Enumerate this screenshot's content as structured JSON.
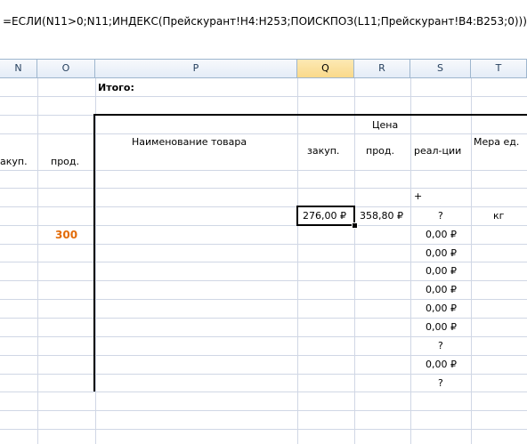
{
  "formula_bar": {
    "text": "=ЕСЛИ(N11>0;N11;ИНДЕКС(Прейскурант!H4:H253;ПОИСКПОЗ(L11;Прейскурант!B4:B253;0)))"
  },
  "columns": [
    "N",
    "O",
    "P",
    "Q",
    "R",
    "S",
    "T"
  ],
  "selected_column": "Q",
  "cells": {
    "itogo": "Итого:",
    "tsena": "Цена",
    "naimenovanie": "Наименование товара",
    "zakup": "закуп.",
    "prod": "прод.",
    "realtsii": "реал-ции",
    "mera": "Мера ед.",
    "n_header": "акуп.",
    "o_header": "прод.",
    "plus": "+",
    "o_value": "300",
    "q_value": "276,00 ₽",
    "r_value": "358,80 ₽",
    "s_values": [
      "?",
      "0,00 ₽",
      "0,00 ₽",
      "0,00 ₽",
      "0,00 ₽",
      "0,00 ₽",
      "0,00 ₽",
      "?",
      "0,00 ₽",
      "?"
    ],
    "t_value": "кг"
  },
  "colors": {
    "highlight_value": "#e36c09",
    "grid": "#d0d7e5",
    "header_selected": "#f9d98a"
  }
}
